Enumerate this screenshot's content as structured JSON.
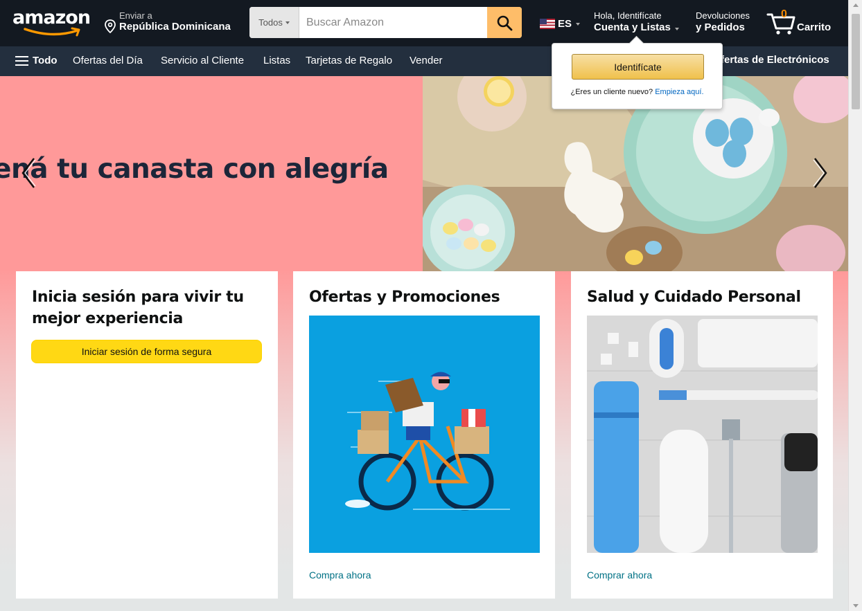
{
  "colors": {
    "topbar": "#131921",
    "navbar": "#232f3e",
    "accent": "#febd69",
    "cart_count": "#f08804",
    "link": "#007185",
    "hero_bg": "#ff9999"
  },
  "header": {
    "logo_text": "amazon",
    "deliver_label": "Enviar a",
    "deliver_location": "República Dominicana",
    "search_category": "Todos",
    "search_placeholder": "Buscar Amazon",
    "language": "ES",
    "account_greeting": "Hola, Identifícate",
    "account_label": "Cuenta y Listas",
    "returns_top": "Devoluciones",
    "returns_bottom": "y Pedidos",
    "cart_count": "0",
    "cart_label": "Carrito"
  },
  "nav": {
    "all_label": "Todo",
    "items": [
      "Ofertas del Día",
      "Servicio al Cliente",
      "Listas",
      "Tarjetas de Regalo",
      "Vender"
    ],
    "right_item": "fertas de Electrónicos"
  },
  "signin_popover": {
    "button_label": "Identifícate",
    "new_customer_text": "¿Eres un cliente nuevo?",
    "start_here_link": "Empieza aquí."
  },
  "hero": {
    "title": "ená tu canasta con alegría"
  },
  "cards": [
    {
      "title": "Inicia sesión para vivir tu mejor experiencia",
      "button": "Iniciar sesión de forma segura"
    },
    {
      "title": "Ofertas y Promociones",
      "link": "Compra ahora",
      "image_desc": "cyclist-delivery-illustration"
    },
    {
      "title": "Salud y Cuidado Personal",
      "link": "Comprar ahora",
      "image_desc": "personal-care-products-photo"
    }
  ],
  "icons": [
    "location-pin-icon",
    "search-icon",
    "us-flag-icon",
    "cart-icon",
    "hamburger-menu-icon",
    "chevron-left-icon",
    "chevron-right-icon"
  ]
}
